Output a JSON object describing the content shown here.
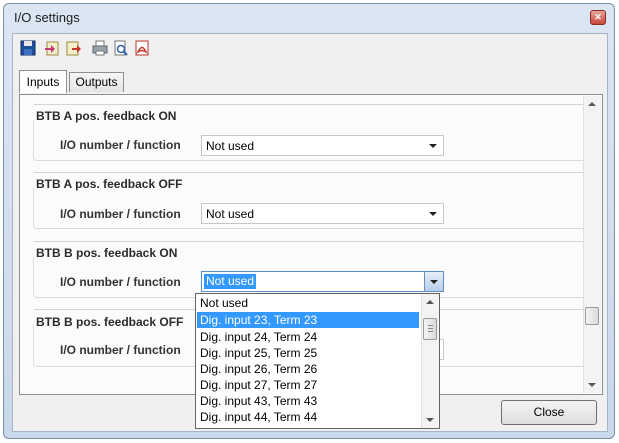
{
  "window": {
    "title": "I/O settings",
    "close_icon": "close-icon"
  },
  "toolbar": {
    "icons": [
      "save-icon",
      "import-icon",
      "export-icon",
      "print-icon",
      "print-preview-icon",
      "pdf-icon"
    ]
  },
  "tabs": [
    {
      "label": "Inputs",
      "active": true
    },
    {
      "label": "Outputs",
      "active": false
    }
  ],
  "groups": [
    {
      "title": "BTB A pos. feedback ON",
      "field_label": "I/O number / function",
      "value": "Not used"
    },
    {
      "title": "BTB A pos. feedback OFF",
      "field_label": "I/O number / function",
      "value": "Not used"
    },
    {
      "title": "BTB B pos. feedback ON",
      "field_label": "I/O number / function",
      "value": "Not used",
      "open": true
    },
    {
      "title": "BTB B pos. feedback OFF",
      "field_label": "I/O number / function",
      "value": ""
    }
  ],
  "dropdown": {
    "selected_index": 1,
    "options": [
      "Not used",
      "Dig. input 23, Term  23",
      "Dig. input 24, Term  24",
      "Dig. input 25, Term  25",
      "Dig. input 26, Term  26",
      "Dig. input 27, Term  27",
      "Dig. input 43, Term  43",
      "Dig. input 44, Term  44"
    ]
  },
  "buttons": {
    "close": "Close"
  },
  "colors": {
    "selection": "#3399ff",
    "title_bar": "#dbe6f3",
    "panel": "#fbfbfb"
  }
}
